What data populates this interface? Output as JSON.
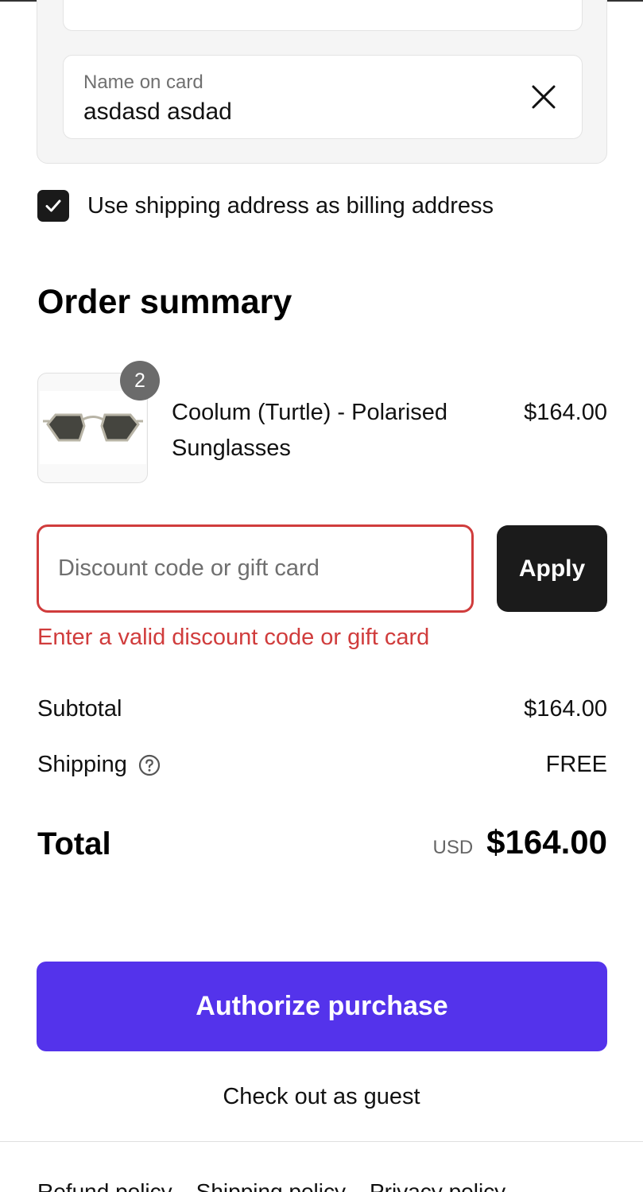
{
  "payment": {
    "name_on_card": {
      "label": "Name on card",
      "value": "asdasd asdad"
    }
  },
  "billing": {
    "checked": true,
    "label": "Use shipping address as billing address"
  },
  "order_summary": {
    "title": "Order summary",
    "item": {
      "quantity": "2",
      "name": "Coolum (Turtle) - Polarised Sunglasses",
      "price": "$164.00"
    },
    "discount": {
      "placeholder": "Discount code or gift card",
      "apply_label": "Apply",
      "error": "Enter a valid discount code or gift card"
    },
    "subtotal": {
      "label": "Subtotal",
      "value": "$164.00"
    },
    "shipping": {
      "label": "Shipping",
      "value": "FREE"
    },
    "total": {
      "label": "Total",
      "currency": "USD",
      "value": "$164.00"
    }
  },
  "actions": {
    "authorize_label": "Authorize purchase",
    "guest_label": "Check out as guest"
  },
  "footer": {
    "links": [
      "Refund policy",
      "Shipping policy",
      "Privacy policy"
    ]
  },
  "colors": {
    "primary_button": "#5433eb",
    "error": "#d03c3c",
    "dark_button": "#1b1b1b"
  }
}
